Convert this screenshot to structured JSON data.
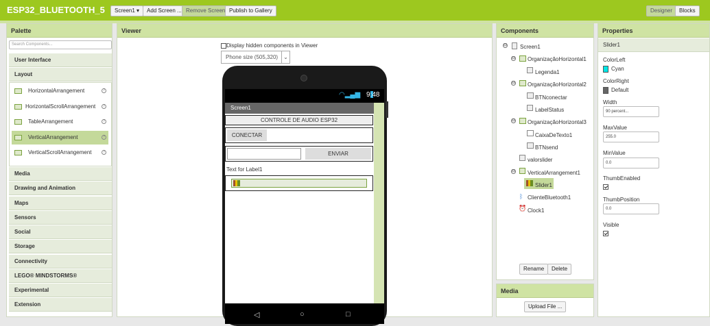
{
  "app": {
    "title": "ESP32_BLUETOOTH_5"
  },
  "toolbar": {
    "screen_select": "Screen1 ▾",
    "add_screen": "Add Screen ...",
    "remove_screen": "Remove Screen",
    "publish": "Publish to Gallery",
    "designer": "Designer",
    "blocks": "Blocks"
  },
  "palette": {
    "title": "Palette",
    "search_placeholder": "Search Components...",
    "categories": [
      "User Interface",
      "Layout",
      "Media",
      "Drawing and Animation",
      "Maps",
      "Sensors",
      "Social",
      "Storage",
      "Connectivity",
      "LEGO® MINDSTORMS®",
      "Experimental",
      "Extension"
    ],
    "layout_items": [
      "HorizontalArrangement",
      "HorizontalScrollArrangement",
      "TableArrangement",
      "VerticalArrangement",
      "VerticalScrollArrangement"
    ],
    "help": "?"
  },
  "viewer": {
    "title": "Viewer",
    "hidden_label": "Display hidden components in Viewer",
    "size_select": "Phone size (505,320)",
    "status_time": "9:48",
    "screen_title": "Screen1",
    "label_controle": "CONTROLE DE AUDIO ESP32",
    "btn_conectar": "CONECTAR",
    "btn_enviar": "ENVIAR",
    "label1": "Text for Label1"
  },
  "components": {
    "title": "Components",
    "tree": [
      "Screen1",
      "OrganizaçãoHorizontal1",
      "Legenda1",
      "OrganizaçãoHorizontal2",
      "BTNconectar",
      "LabelStatus",
      "OrganizaçãoHorizontal3",
      "CaixaDeTexto1",
      "BTNsend",
      "valorslider",
      "VerticalArrangement1",
      "Slider1",
      "ClienteBluetooth1",
      "Clock1"
    ],
    "toggle_minus": "⊟",
    "rename": "Rename",
    "delete": "Delete"
  },
  "media": {
    "title": "Media",
    "upload": "Upload File ..."
  },
  "properties": {
    "title": "Properties",
    "component": "Slider1",
    "color_left_label": "ColorLeft",
    "color_left": "Cyan",
    "color_left_hex": "#00e5e5",
    "color_right_label": "ColorRight",
    "color_right": "Default",
    "color_right_hex": "#666666",
    "width_label": "Width",
    "width": "90 percent...",
    "max_label": "MaxValue",
    "max": "255.0",
    "min_label": "MinValue",
    "min": "0.0",
    "thumb_enabled_label": "ThumbEnabled",
    "thumb_pos_label": "ThumbPosition",
    "thumb_pos": "0.0",
    "visible_label": "Visible"
  }
}
